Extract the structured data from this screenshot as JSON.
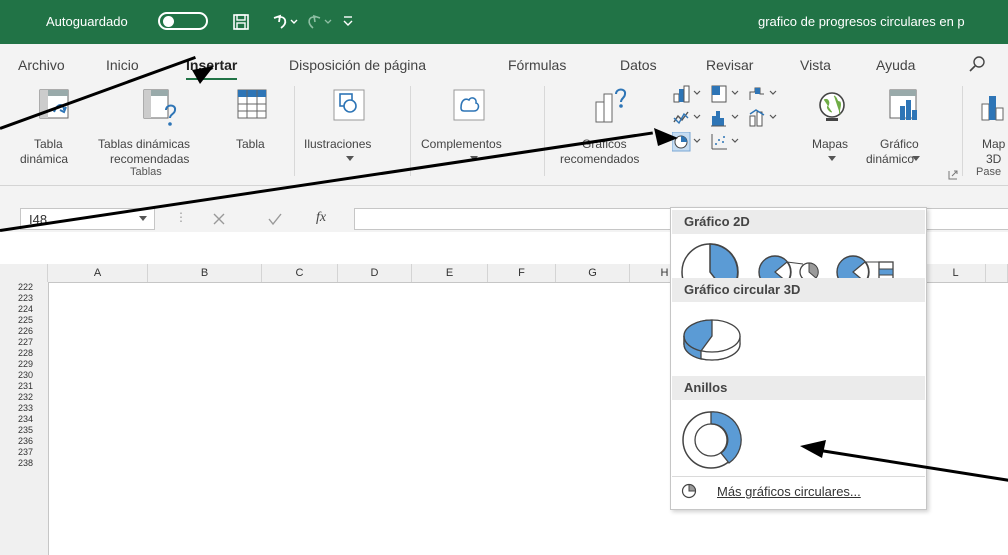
{
  "titlebar": {
    "autosave_label": "Autoguardado",
    "doc_title": "grafico de progresos circulares en p"
  },
  "tabs": [
    "Archivo",
    "Inicio",
    "Insertar",
    "Disposición de página",
    "Fórmulas",
    "Datos",
    "Revisar",
    "Vista",
    "Ayuda"
  ],
  "ribbon": {
    "tabla_dinamica": [
      "Tabla",
      "dinámica"
    ],
    "tablas_recomendadas": [
      "Tablas dinámicas",
      "recomendadas"
    ],
    "tabla": "Tabla",
    "group_tablas": "Tablas",
    "ilustraciones": "Ilustraciones",
    "complementos": "Complementos",
    "graficos_recomendados": [
      "Gráficos",
      "recomendados"
    ],
    "mapas": "Mapas",
    "grafico_dinamico": [
      "Gráfico",
      "dinámico"
    ],
    "mapa3d": [
      "Map",
      "3D"
    ],
    "group_pase": "Pase"
  },
  "formula_bar": {
    "cell_ref": "I48",
    "fx": "fx"
  },
  "columns": [
    "A",
    "B",
    "C",
    "D",
    "E",
    "F",
    "G",
    "H",
    "L"
  ],
  "rows": [
    "222",
    "223",
    "224",
    "225",
    "226",
    "227",
    "228",
    "229",
    "230",
    "231",
    "232",
    "233",
    "234",
    "235",
    "236",
    "237",
    "238"
  ],
  "dropdown": {
    "section_2d": "Gráfico 2D",
    "section_3d": "Gráfico circular 3D",
    "section_anillos": "Anillos",
    "more": "Más gráficos circulares..."
  },
  "colors": {
    "excel_green": "#217346",
    "chart_blue": "#5b9bd5"
  }
}
